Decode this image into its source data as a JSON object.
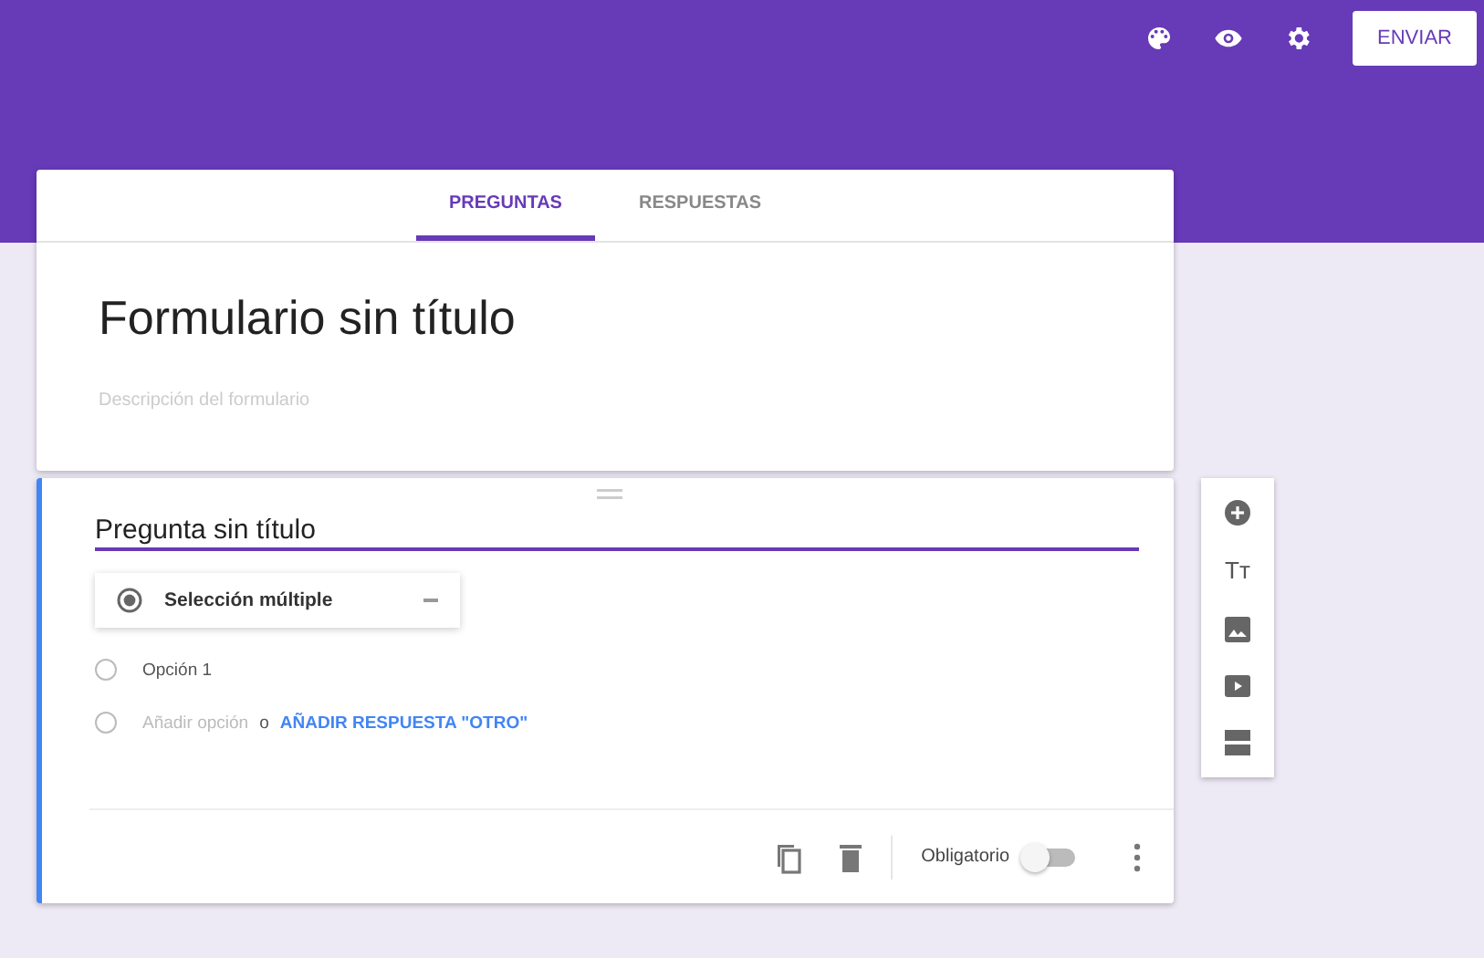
{
  "header": {
    "send_button": "ENVIAR"
  },
  "tabs": [
    {
      "label": "PREGUNTAS",
      "selected": true
    },
    {
      "label": "RESPUESTAS",
      "selected": false
    }
  ],
  "form": {
    "title": "Formulario sin título",
    "description_placeholder": "Descripción del formulario"
  },
  "question": {
    "title": "Pregunta sin título",
    "type": "Selección múltiple",
    "options": [
      {
        "label": "Opción 1",
        "selected": false
      }
    ],
    "add_option": "Añadir opción",
    "add_option_selected": false,
    "or": "o",
    "add_other": "AÑADIR RESPUESTA \"OTRO\"",
    "required_label": "Obligatorio",
    "required": false
  },
  "side_toolbar": {
    "text_glyph": "Tт"
  }
}
